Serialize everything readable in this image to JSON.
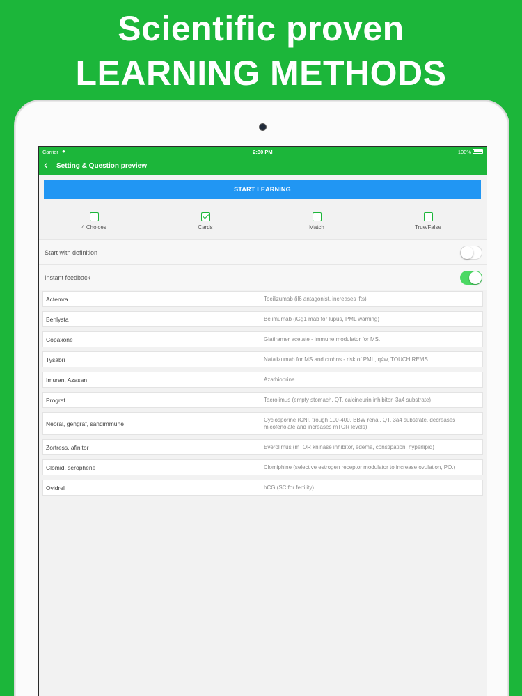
{
  "headline": {
    "line1": "Scientific proven",
    "line2": "LEARNING METHODS"
  },
  "status_bar": {
    "carrier": "Carrier",
    "time": "2:30 PM",
    "battery": "100%"
  },
  "nav": {
    "back_glyph": "‹",
    "title": "Setting & Question preview"
  },
  "start_button": {
    "label": "START LEARNING"
  },
  "modes": [
    {
      "label": "4 Choices",
      "checked": false
    },
    {
      "label": "Cards",
      "checked": true
    },
    {
      "label": "Match",
      "checked": false
    },
    {
      "label": "True/False",
      "checked": false
    }
  ],
  "settings": [
    {
      "label": "Start with definition",
      "on": false
    },
    {
      "label": "Instant feedback",
      "on": true
    }
  ],
  "cards": [
    {
      "term": "Actemra",
      "definition": "Tocilizumab (il6 antagonist, increases lfts)"
    },
    {
      "term": "Benlysta",
      "definition": "Belimumab (iGg1 mab for lupus, PML warning)"
    },
    {
      "term": "Copaxone",
      "definition": "Glatiramer acetate - immune modulator for MS."
    },
    {
      "term": "Tysabri",
      "definition": "Natalizumab for MS and crohns - risk of PML, q4w, TOUCH REMS"
    },
    {
      "term": "Imuran, Azasan",
      "definition": "Azathioprine"
    },
    {
      "term": "Prograf",
      "definition": "Tacrolimus (empty stomach, QT, calcineurin inhibitor, 3a4 substrate)"
    },
    {
      "term": "Neoral, gengraf, sandimmune",
      "definition": "Cyclosporine (CNI, trough 100-400, BBW renal, QT, 3a4 substrate, decreases micofenolate and increases mTOR levels)"
    },
    {
      "term": "Zortress, afinitor",
      "definition": "Everolimus (mTOR kninase inhibitor, edema, constipation, hyperlipid)"
    },
    {
      "term": "Clomid, serophene",
      "definition": "Clomiphine (selective estrogen receptor modulator to increase ovulation, PO.)"
    },
    {
      "term": "Ovidrel",
      "definition": "hCG (SC for fertility)"
    }
  ],
  "colors": {
    "brand_green": "#1cb63a",
    "button_blue": "#2196f3",
    "toggle_on": "#4cd964"
  },
  "icons": {
    "wifi": "wifi-icon",
    "battery": "battery-icon",
    "back": "chevron-left-icon",
    "camera": "camera-icon"
  }
}
